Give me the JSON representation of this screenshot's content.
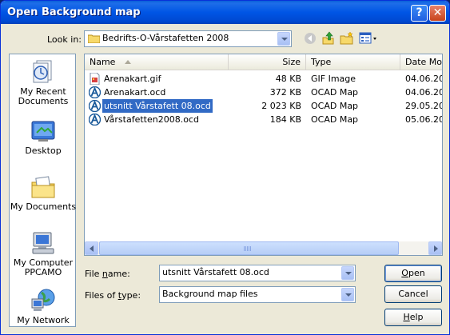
{
  "window": {
    "title": "Open Background map",
    "help_button": "?",
    "close_button": "✕"
  },
  "lookin": {
    "label": "Look in:",
    "value": "Bedrifts-O-Vårstafetten 2008"
  },
  "places": [
    {
      "label": "My Recent Documents",
      "icon": "recent-documents-icon"
    },
    {
      "label": "Desktop",
      "icon": "desktop-icon"
    },
    {
      "label": "My Documents",
      "icon": "my-documents-icon"
    },
    {
      "label": "My Computer PPCAMO",
      "icon": "my-computer-icon"
    },
    {
      "label": "My Network",
      "icon": "network-icon"
    }
  ],
  "columns": {
    "name": "Name",
    "size": "Size",
    "type": "Type",
    "date": "Date Mo"
  },
  "files": [
    {
      "name": "Arenakart.gif",
      "size": "48 KB",
      "type": "GIF Image",
      "date": "04.06.20",
      "icon": "gif-file-icon"
    },
    {
      "name": "Arenakart.ocd",
      "size": "372 KB",
      "type": "OCAD Map",
      "date": "04.06.20",
      "icon": "ocad-file-icon"
    },
    {
      "name": "utsnitt Vårstafett 08.ocd",
      "size": "2 023 KB",
      "type": "OCAD Map",
      "date": "29.05.20",
      "icon": "ocad-file-icon",
      "selected": true
    },
    {
      "name": "Vårstafetten2008.ocd",
      "size": "184 KB",
      "type": "OCAD Map",
      "date": "05.06.20",
      "icon": "ocad-file-icon"
    }
  ],
  "filename": {
    "label_pre": "File ",
    "label_u": "n",
    "label_post": "ame:",
    "value": "utsnitt Vårstafett 08.ocd"
  },
  "filetype": {
    "label_pre": "Files of ",
    "label_u": "t",
    "label_post": "ype:",
    "value": "Background map files"
  },
  "buttons": {
    "open_u": "O",
    "open_rest": "pen",
    "cancel": "Cancel",
    "help_u": "H",
    "help_rest": "elp"
  },
  "colors": {
    "titlebar": "#0055e5",
    "selection": "#316ac5",
    "dialog": "#ece9d8"
  }
}
